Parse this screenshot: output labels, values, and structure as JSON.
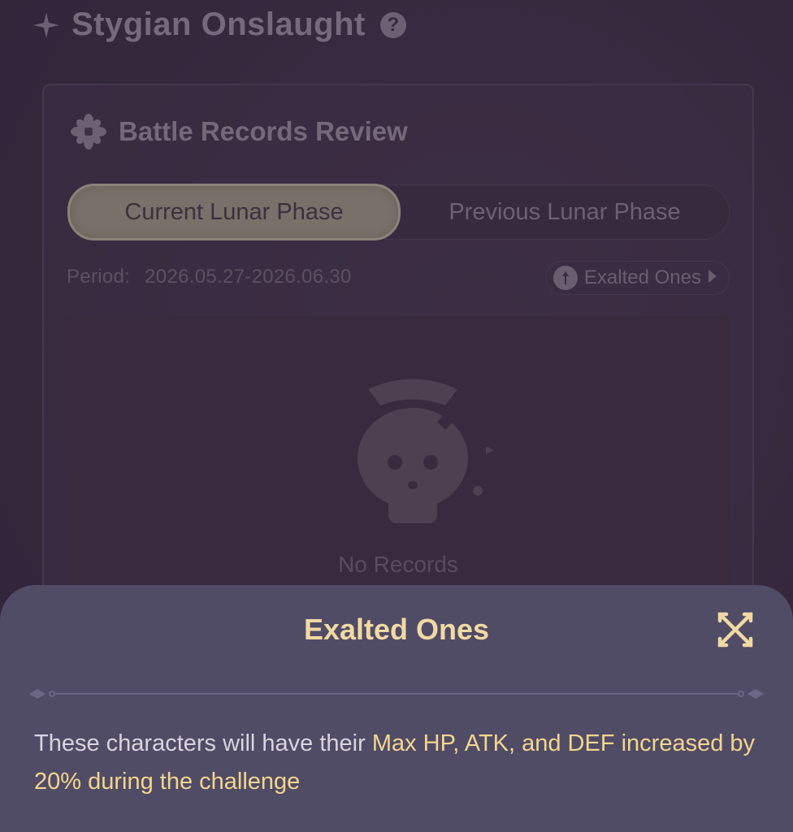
{
  "header": {
    "title": "Stygian Onslaught",
    "help_icon": "question-icon"
  },
  "card": {
    "title": "Battle Records Review",
    "tabs": [
      {
        "label": "Current Lunar Phase",
        "active": true
      },
      {
        "label": "Previous Lunar Phase",
        "active": false
      }
    ],
    "period_label": "Period:",
    "period_value": "2026.05.27-2026.06.30",
    "exalted_link": "Exalted Ones",
    "empty_text": "No Records"
  },
  "sheet": {
    "title": "Exalted Ones",
    "desc_plain": "These characters will have their ",
    "desc_highlight": "Max HP, ATK, and DEF increased by 20% during the challenge"
  },
  "colors": {
    "accent_gold": "#f3d58e",
    "sheet_bg": "#504c66",
    "page_bg": "#3a2b42"
  }
}
